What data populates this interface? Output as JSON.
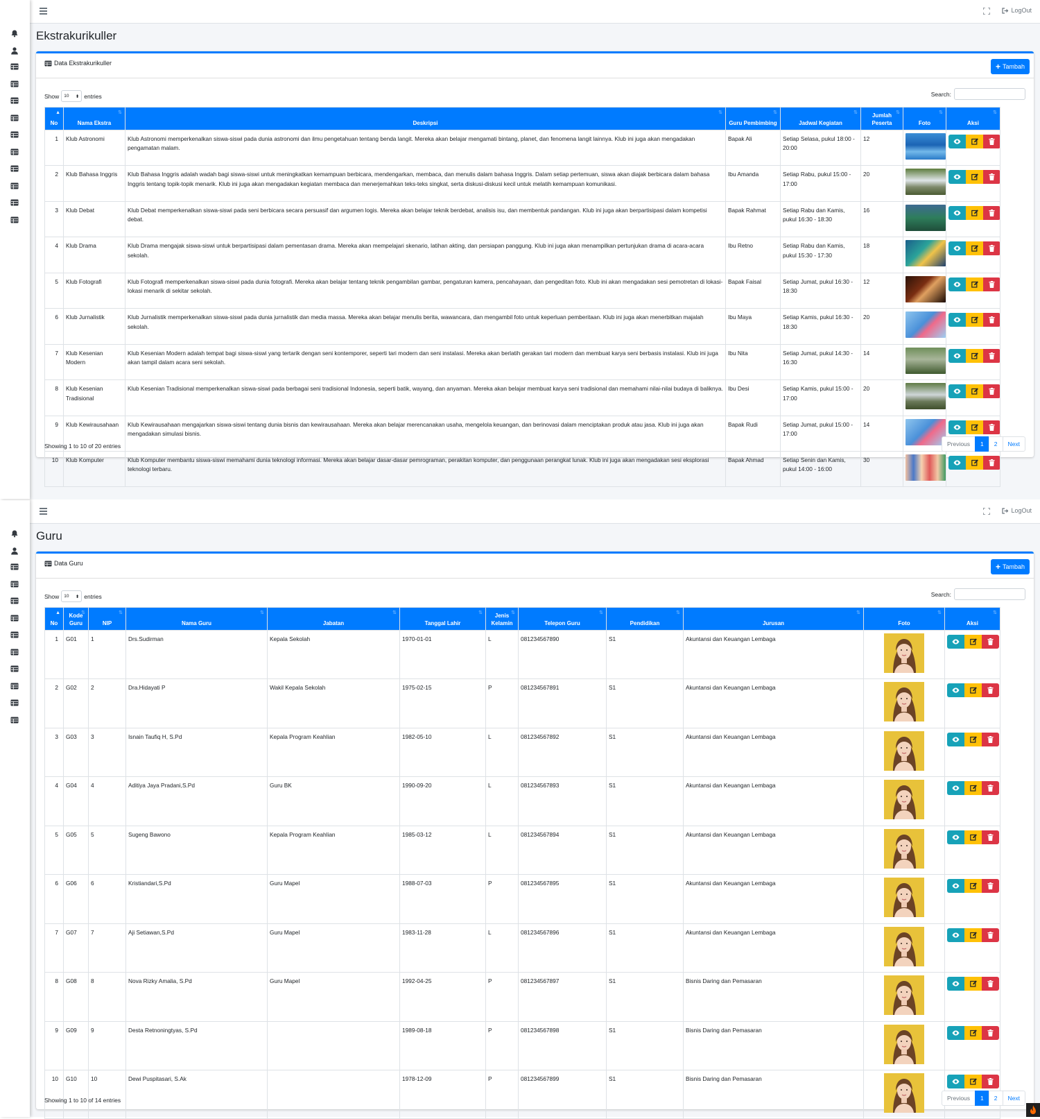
{
  "colors": {
    "primary": "#007bff",
    "info": "#17a2b8",
    "warning": "#ffc107",
    "danger": "#dc3545",
    "content_bg": "#f4f6f9"
  },
  "icons": {
    "sidebar": [
      "bell-icon",
      "user-icon",
      "table-icon",
      "table-icon",
      "table-icon",
      "table-icon",
      "table-icon",
      "table-icon",
      "table-icon",
      "table-icon",
      "table-icon",
      "table-icon"
    ],
    "toolbar": [
      "hamburger-icon",
      "fullscreen-icon",
      "logout-icon"
    ],
    "actions": [
      "eye-icon",
      "edit-icon",
      "trash-icon"
    ]
  },
  "topbar": {
    "logout_label": "LogOut"
  },
  "ekstra": {
    "page_title": "Ekstrakurikuller",
    "card_title": "Data Ekstrakurikuller",
    "add_label": "Tambah",
    "show_label": "Show",
    "entries_value": "10",
    "entries_label": "entries",
    "search_label": "Search:",
    "columns": [
      "No",
      "Nama Ekstra",
      "Deskripsi",
      "Guru Pembimbing",
      "Jadwal Kegiatan",
      "Jumlah Peserta",
      "Foto",
      "Aksi"
    ],
    "rows": [
      {
        "no": "1",
        "nama": "Klub Astronomi",
        "deskripsi": "Klub Astronomi memperkenalkan siswa-siswi pada dunia astronomi dan ilmu pengetahuan tentang benda langit. Mereka akan belajar mengamati bintang, planet, dan fenomena langit lainnya. Klub ini juga akan mengadakan pengamatan malam.",
        "guru": "Bapak Ali",
        "jadwal": "Setiap Selasa, pukul 18:00 - 20:00",
        "peserta": "12"
      },
      {
        "no": "2",
        "nama": "Klub Bahasa Inggris",
        "deskripsi": "Klub Bahasa Inggris adalah wadah bagi siswa-siswi untuk meningkatkan kemampuan berbicara, mendengarkan, membaca, dan menulis dalam bahasa Inggris. Dalam setiap pertemuan, siswa akan diajak berbicara dalam bahasa Inggris tentang topik-topik menarik. Klub ini juga akan mengadakan kegiatan membaca dan menerjemahkan teks-teks singkat, serta diskusi-diskusi kecil untuk melatih kemampuan komunikasi.",
        "guru": "Ibu Amanda",
        "jadwal": "Setiap Rabu, pukul 15:00 - 17:00",
        "peserta": "20"
      },
      {
        "no": "3",
        "nama": "Klub Debat",
        "deskripsi": "Klub Debat memperkenalkan siswa-siswi pada seni berbicara secara persuasif dan argumen logis. Mereka akan belajar teknik berdebat, analisis isu, dan membentuk pandangan. Klub ini juga akan berpartisipasi dalam kompetisi debat.",
        "guru": "Bapak Rahmat",
        "jadwal": "Setiap Rabu dan Kamis, pukul 16:30 - 18:30",
        "peserta": "16"
      },
      {
        "no": "4",
        "nama": "Klub Drama",
        "deskripsi": "Klub Drama mengajak siswa-siswi untuk berpartisipasi dalam pementasan drama. Mereka akan mempelajari skenario, latihan akting, dan persiapan panggung. Klub ini juga akan menampilkan pertunjukan drama di acara-acara sekolah.",
        "guru": "Ibu Retno",
        "jadwal": "Setiap Rabu dan Kamis, pukul 15:30 - 17:30",
        "peserta": "18"
      },
      {
        "no": "5",
        "nama": "Klub Fotografi",
        "deskripsi": "Klub Fotografi memperkenalkan siswa-siswi pada dunia fotografi. Mereka akan belajar tentang teknik pengambilan gambar, pengaturan kamera, pencahayaan, dan pengeditan foto. Klub ini akan mengadakan sesi pemotretan di lokasi-lokasi menarik di sekitar sekolah.",
        "guru": "Bapak Faisal",
        "jadwal": "Setiap Jumat, pukul 16:30 - 18:30",
        "peserta": "12"
      },
      {
        "no": "6",
        "nama": "Klub Jurnalistik",
        "deskripsi": "Klub Jurnalistik memperkenalkan siswa-siswi pada dunia jurnalistik dan media massa. Mereka akan belajar menulis berita, wawancara, dan mengambil foto untuk keperluan pemberitaan. Klub ini juga akan menerbitkan majalah sekolah.",
        "guru": "Ibu Maya",
        "jadwal": "Setiap Kamis, pukul 16:30 - 18:30",
        "peserta": "20"
      },
      {
        "no": "7",
        "nama": "Klub Kesenian Modern",
        "deskripsi": "Klub Kesenian Modern adalah tempat bagi siswa-siswi yang tertarik dengan seni kontemporer, seperti tari modern dan seni instalasi. Mereka akan berlatih gerakan tari modern dan membuat karya seni berbasis instalasi. Klub ini juga akan tampil dalam acara seni sekolah.",
        "guru": "Ibu Nita",
        "jadwal": "Setiap Jumat, pukul 14:30 - 16:30",
        "peserta": "14"
      },
      {
        "no": "8",
        "nama": "Klub Kesenian Tradisional",
        "deskripsi": "Klub Kesenian Tradisional memperkenalkan siswa-siswi pada berbagai seni tradisional Indonesia, seperti batik, wayang, dan anyaman. Mereka akan belajar membuat karya seni tradisional dan memahami nilai-nilai budaya di baliknya.",
        "guru": "Ibu Desi",
        "jadwal": "Setiap Kamis, pukul 15:00 - 17:00",
        "peserta": "20"
      },
      {
        "no": "9",
        "nama": "Klub Kewirausahaan",
        "deskripsi": "Klub Kewirausahaan mengajarkan siswa-siswi tentang dunia bisnis dan kewirausahaan. Mereka akan belajar merencanakan usaha, mengelola keuangan, dan berinovasi dalam menciptakan produk atau jasa. Klub ini juga akan mengadakan simulasi bisnis.",
        "guru": "Bapak Rudi",
        "jadwal": "Setiap Jumat, pukul 15:00 - 17:00",
        "peserta": "14"
      },
      {
        "no": "10",
        "nama": "Klub Komputer",
        "deskripsi": "Klub Komputer membantu siswa-siswi memahami dunia teknologi informasi. Mereka akan belajar dasar-dasar pemrograman, perakitan komputer, dan penggunaan perangkat lunak. Klub ini juga akan mengadakan sesi eksplorasi teknologi terbaru.",
        "guru": "Bapak Ahmad",
        "jadwal": "Setiap Senin dan Kamis, pukul 14:00 - 16:00",
        "peserta": "30"
      }
    ],
    "info": "Showing 1 to 10 of 20 entries",
    "pager": {
      "prev": "Previous",
      "p1": "1",
      "p2": "2",
      "next": "Next"
    }
  },
  "guru": {
    "page_title": "Guru",
    "card_title": "Data Guru",
    "add_label": "Tambah",
    "show_label": "Show",
    "entries_value": "10",
    "entries_label": "entries",
    "search_label": "Search:",
    "columns": [
      "No",
      "Kode Guru",
      "NIP",
      "Nama Guru",
      "Jabatan",
      "Tanggal Lahir",
      "Jenis Kelamin",
      "Telepon Guru",
      "Pendidikan",
      "Jurusan",
      "Foto",
      "Aksi"
    ],
    "rows": [
      {
        "no": "1",
        "kode": "G01",
        "nip": "1",
        "nama": "Drs.Sudirman",
        "jabatan": "Kepala Sekolah",
        "lahir": "1970-01-01",
        "jk": "L",
        "telp": "081234567890",
        "pend": "S1",
        "jurusan": "Akuntansi dan Keuangan Lembaga"
      },
      {
        "no": "2",
        "kode": "G02",
        "nip": "2",
        "nama": "Dra.Hidayati P",
        "jabatan": "Wakil Kepala Sekolah",
        "lahir": "1975-02-15",
        "jk": "P",
        "telp": "081234567891",
        "pend": "S1",
        "jurusan": "Akuntansi dan Keuangan Lembaga"
      },
      {
        "no": "3",
        "kode": "G03",
        "nip": "3",
        "nama": "Isnain Taufiq H, S.Pd",
        "jabatan": "Kepala Program Keahlian",
        "lahir": "1982-05-10",
        "jk": "L",
        "telp": "081234567892",
        "pend": "S1",
        "jurusan": "Akuntansi dan Keuangan Lembaga"
      },
      {
        "no": "4",
        "kode": "G04",
        "nip": "4",
        "nama": "Aditiya Jaya Pradani,S.Pd",
        "jabatan": "Guru BK",
        "lahir": "1990-09-20",
        "jk": "L",
        "telp": "081234567893",
        "pend": "S1",
        "jurusan": "Akuntansi dan Keuangan Lembaga"
      },
      {
        "no": "5",
        "kode": "G05",
        "nip": "5",
        "nama": "Sugeng Bawono",
        "jabatan": "Kepala Program Keahlian",
        "lahir": "1985-03-12",
        "jk": "L",
        "telp": "081234567894",
        "pend": "S1",
        "jurusan": "Akuntansi dan Keuangan Lembaga"
      },
      {
        "no": "6",
        "kode": "G06",
        "nip": "6",
        "nama": "Kristiandari,S.Pd",
        "jabatan": "Guru Mapel",
        "lahir": "1988-07-03",
        "jk": "P",
        "telp": "081234567895",
        "pend": "S1",
        "jurusan": "Akuntansi dan Keuangan Lembaga"
      },
      {
        "no": "7",
        "kode": "G07",
        "nip": "7",
        "nama": "Aji Setiawan,S.Pd",
        "jabatan": "Guru Mapel",
        "lahir": "1983-11-28",
        "jk": "L",
        "telp": "081234567896",
        "pend": "S1",
        "jurusan": "Akuntansi dan Keuangan Lembaga"
      },
      {
        "no": "8",
        "kode": "G08",
        "nip": "8",
        "nama": "Nova Rizky Amalia, S.Pd",
        "jabatan": "Guru Mapel",
        "lahir": "1992-04-25",
        "jk": "P",
        "telp": "081234567897",
        "pend": "S1",
        "jurusan": "Bisnis Daring dan Pemasaran"
      },
      {
        "no": "9",
        "kode": "G09",
        "nip": "9",
        "nama": "Desta Retnoningtyas, S.Pd",
        "jabatan": "",
        "lahir": "1989-08-18",
        "jk": "P",
        "telp": "081234567898",
        "pend": "S1",
        "jurusan": "Bisnis Daring dan Pemasaran"
      },
      {
        "no": "10",
        "kode": "G10",
        "nip": "10",
        "nama": "Dewi Puspitasari, S.Ak",
        "jabatan": "",
        "lahir": "1978-12-09",
        "jk": "P",
        "telp": "081234567899",
        "pend": "S1",
        "jurusan": "Bisnis Daring dan Pemasaran"
      }
    ],
    "info": "Showing 1 to 10 of 14 entries",
    "pager": {
      "prev": "Previous",
      "p1": "1",
      "p2": "2",
      "next": "Next"
    }
  }
}
